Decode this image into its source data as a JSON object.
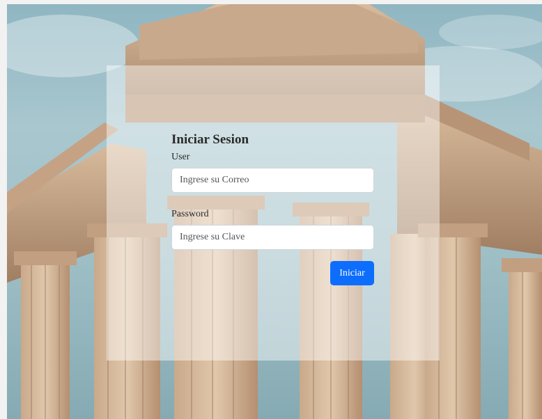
{
  "login": {
    "title": "Iniciar Sesion",
    "user_label": "User",
    "user_placeholder": "Ingrese su Correo",
    "user_value": "",
    "password_label": "Password",
    "password_placeholder": "Ingrese su Clave",
    "password_value": "",
    "submit_label": "Iniciar"
  },
  "colors": {
    "primary_button": "#0d6efd",
    "panel_overlay": "rgba(255,255,255,0.45)"
  }
}
